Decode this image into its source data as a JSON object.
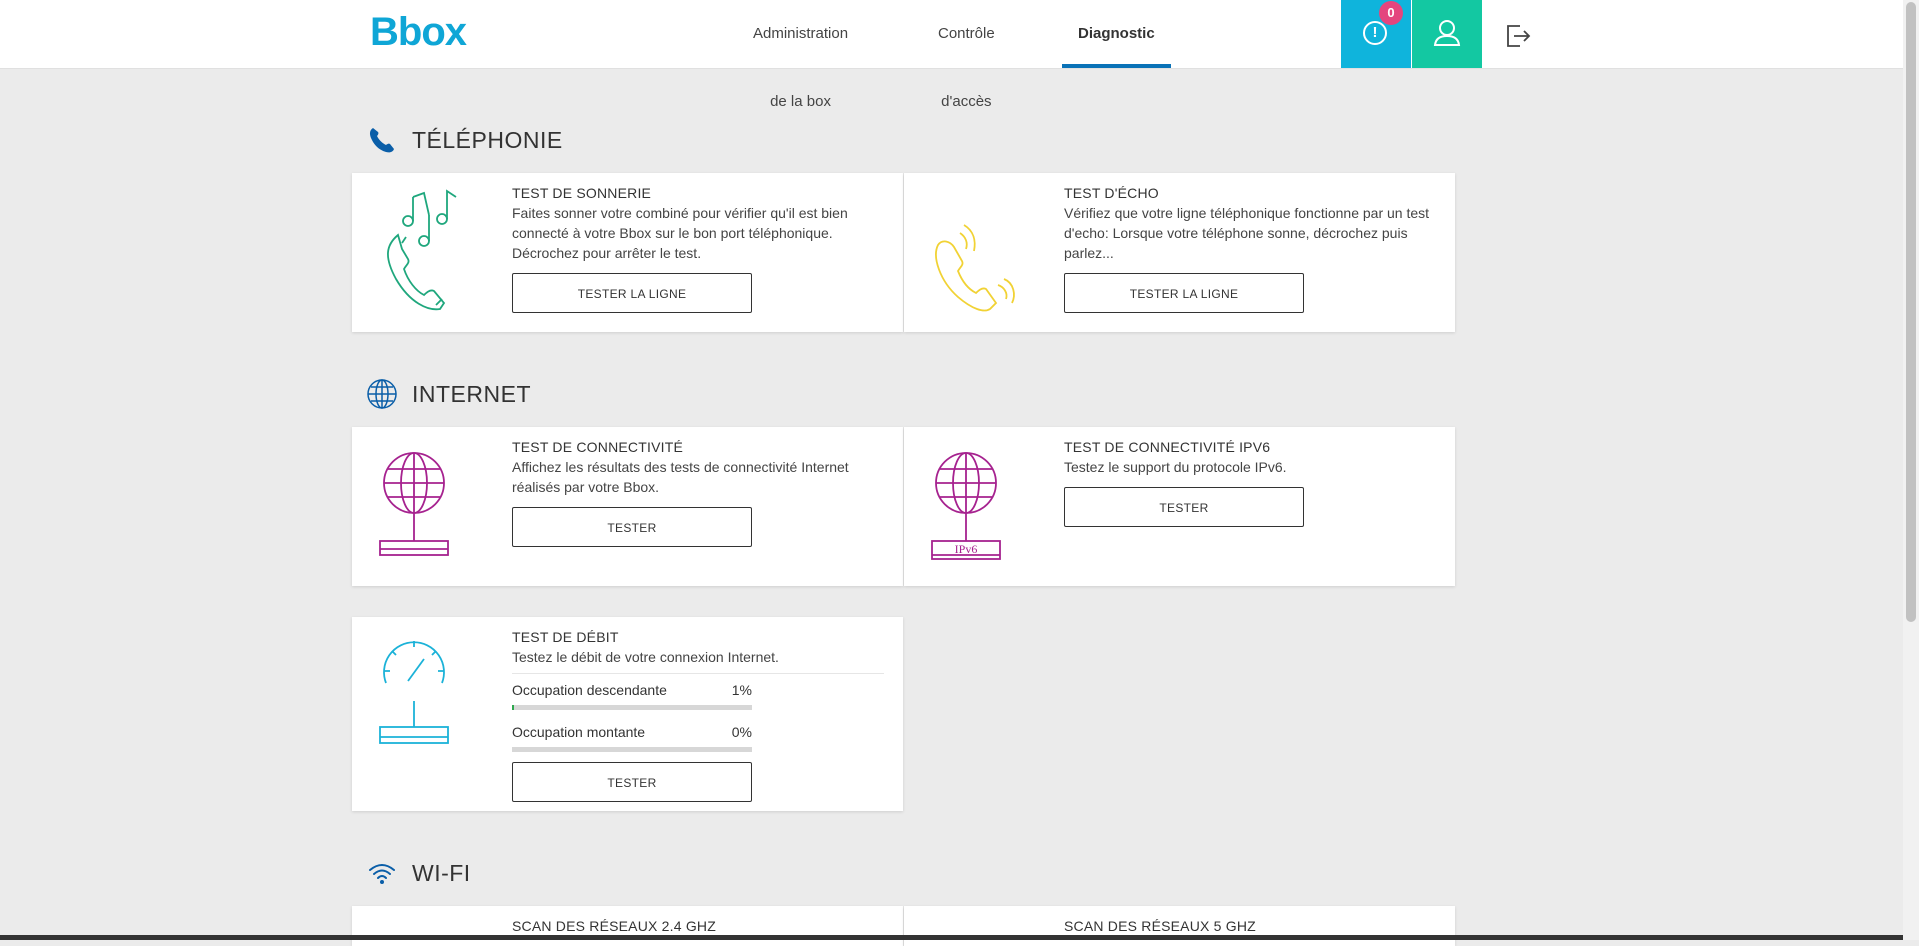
{
  "header": {
    "logo": "Bbox",
    "nav": [
      {
        "label": "Administration de la box",
        "active": false
      },
      {
        "label": "Contrôle d'accès",
        "active": false
      },
      {
        "label": "Diagnostic",
        "active": true
      }
    ],
    "alert_count": "0",
    "alert_symbol": "!"
  },
  "colors": {
    "accent": "#0a72b7",
    "alert_bg": "#0fb4dc",
    "user_bg": "#13c8a2",
    "badge": "#e4457e",
    "telephony_green": "#1fa77d",
    "telephony_yellow": "#f1d234",
    "internet_purple": "#a6228f",
    "speed_blue": "#1bb2d8"
  },
  "sections": {
    "telephony": {
      "title": "TÉLÉPHONIE",
      "cards": [
        {
          "title": "TEST DE SONNERIE",
          "desc": "Faites sonner votre combiné pour vérifier qu'il est bien connecté à votre Bbox sur le bon port téléphonique. Décrochez pour arrêter le test.",
          "button": "TESTER LA LIGNE"
        },
        {
          "title": "TEST D'ÉCHO",
          "desc": "Vérifiez que votre ligne téléphonique fonctionne par un test d'echo: Lorsque votre téléphone sonne, décrochez puis parlez...",
          "button": "TESTER LA LIGNE"
        }
      ]
    },
    "internet": {
      "title": "INTERNET",
      "cards": [
        {
          "title": "TEST DE CONNECTIVITÉ",
          "desc": "Affichez les résultats des tests de connectivité Internet réalisés par votre Bbox.",
          "button": "TESTER"
        },
        {
          "title": "TEST DE CONNECTIVITÉ IPV6",
          "desc": "Testez le support du protocole IPv6.",
          "button": "TESTER",
          "illus_label": "IPv6"
        },
        {
          "title": "TEST DE DÉBIT",
          "desc": "Testez le débit de votre connexion Internet.",
          "down_label": "Occupation descendante",
          "down_value": "1%",
          "down_fraction": 0.01,
          "up_label": "Occupation montante",
          "up_value": "0%",
          "up_fraction": 0,
          "button": "TESTER"
        }
      ]
    },
    "wifi": {
      "title": "WI-FI",
      "cards": [
        {
          "title": "SCAN DES RÉSEAUX 2.4 GHZ"
        },
        {
          "title": "SCAN DES RÉSEAUX 5 GHZ"
        }
      ]
    }
  },
  "icons": [
    "phone-icon",
    "globe-icon",
    "wifi-icon",
    "user-icon",
    "logout-icon",
    "alert-icon"
  ]
}
